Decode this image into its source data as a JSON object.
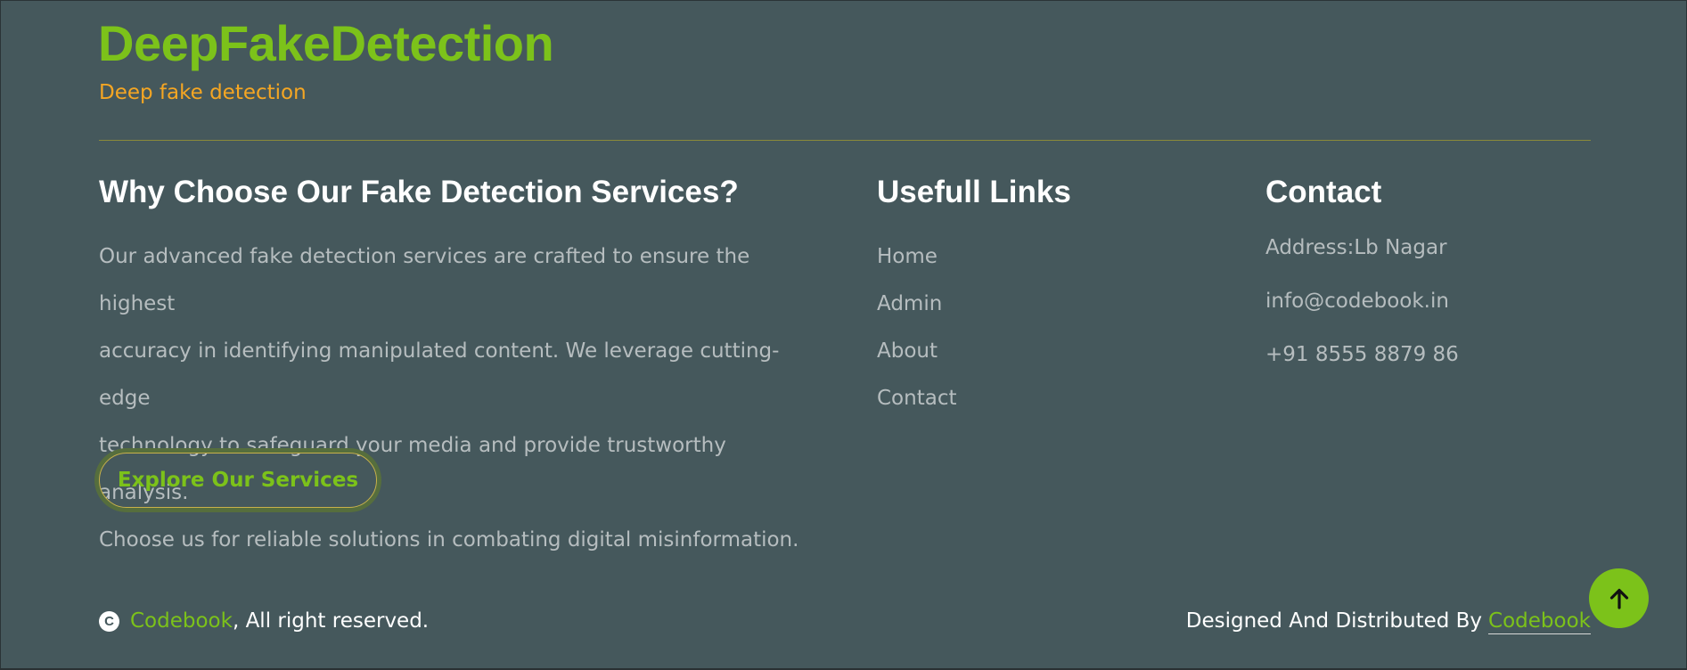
{
  "brand": {
    "title": "DeepFakeDetection",
    "subtitle": "Deep fake detection"
  },
  "about": {
    "heading": "Why Choose Our Fake Detection Services?",
    "lines": [
      "Our advanced fake detection services are crafted to ensure the highest",
      "accuracy in identifying manipulated content. We leverage cutting-edge",
      "technology to safeguard your media and provide trustworthy analysis.",
      "Choose us for reliable solutions in combating digital misinformation."
    ],
    "button_label": "Explore Our Services"
  },
  "links": {
    "heading": "Usefull Links",
    "items": [
      "Home",
      "Admin",
      "About",
      "Contact"
    ]
  },
  "contact": {
    "heading": "Contact",
    "address": "Address:Lb Nagar",
    "email": "info@codebook.in",
    "phone": "+91 8555 8879 86"
  },
  "footer": {
    "copyright_symbol": "C",
    "brand_link": "Codebook",
    "rights_text": ", All right reserved.",
    "designed_by_text": "Designed And Distributed By",
    "designer_link": "Codebook"
  },
  "icons": {
    "copyright": "copyright-icon",
    "back_to_top": "arrow-up-icon"
  },
  "colors": {
    "background": "#45585c",
    "accent_green": "#7cc21a",
    "accent_orange": "#f5a623",
    "muted_text": "#b6bdbf",
    "heading_text": "#ffffff"
  }
}
